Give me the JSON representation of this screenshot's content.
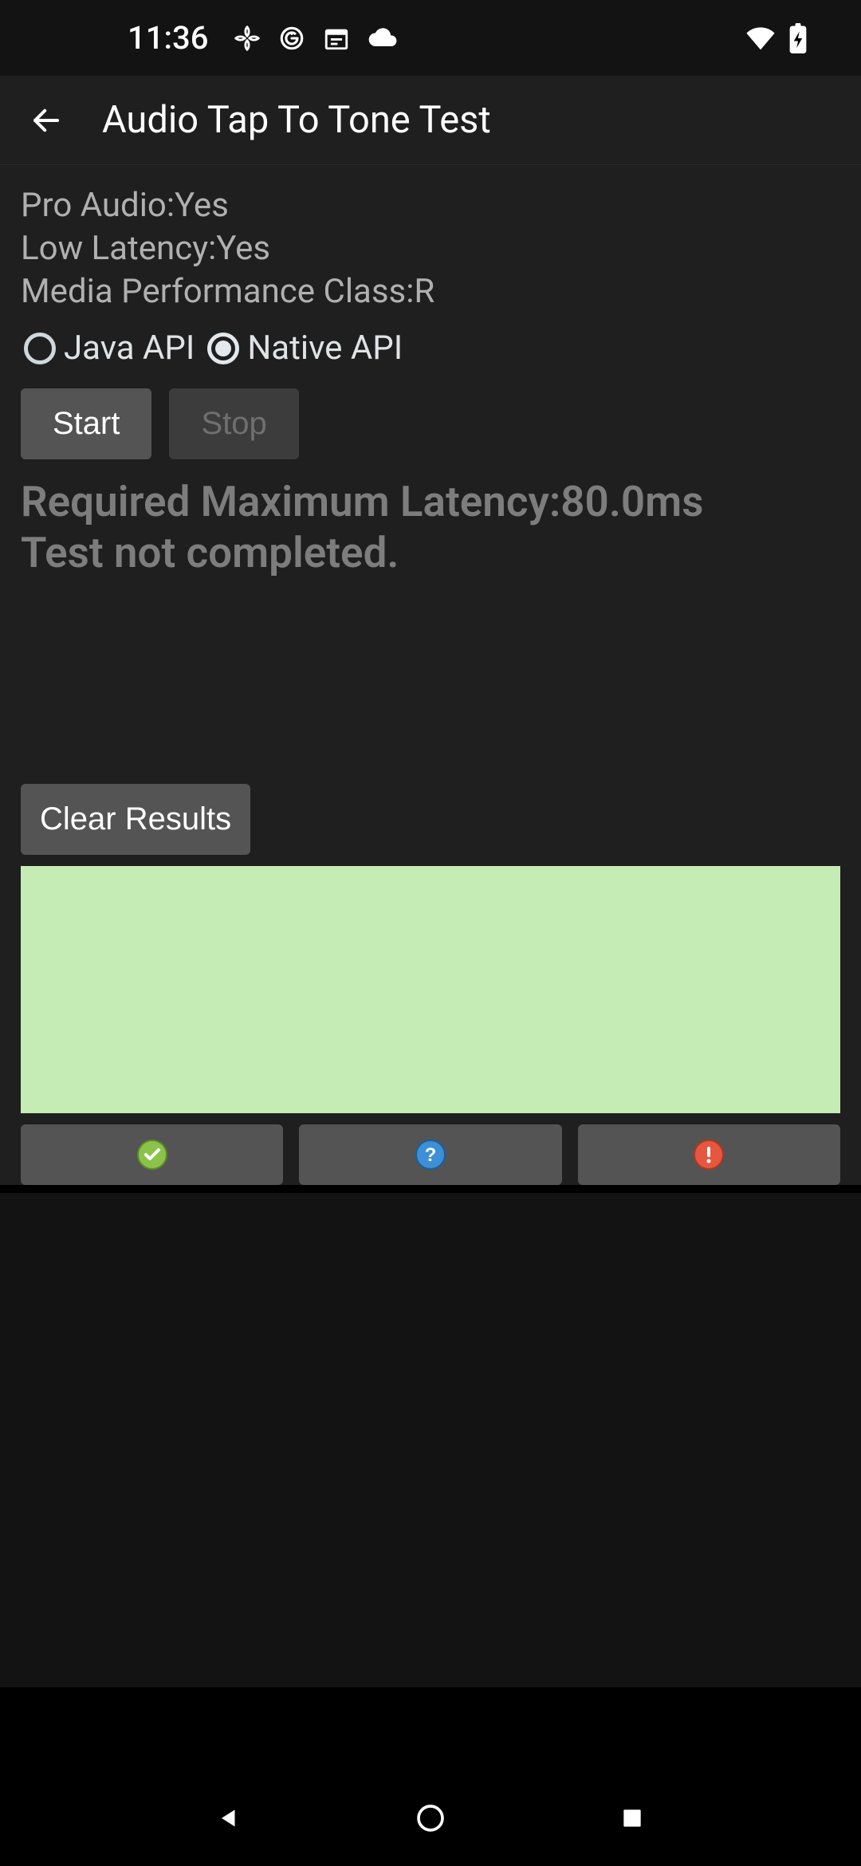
{
  "status_bar": {
    "time": "11:36"
  },
  "app_bar": {
    "title": "Audio Tap To Tone Test"
  },
  "info": {
    "pro_audio": "Pro Audio:Yes",
    "low_latency": "Low Latency:Yes",
    "media_perf_class": "Media Performance Class:R"
  },
  "radios": {
    "java_api": {
      "label": "Java API",
      "selected": false
    },
    "native_api": {
      "label": "Native API",
      "selected": true
    }
  },
  "buttons": {
    "start": "Start",
    "stop": "Stop",
    "clear_results": "Clear Results"
  },
  "results": {
    "req_latency": "Required Maximum Latency:80.0ms",
    "status": "Test not completed."
  },
  "colors": {
    "canvas": "#c5ecb4",
    "pass_icon": "#8bc34a",
    "info_icon": "#2a7cc7",
    "fail_icon": "#e6573f"
  }
}
